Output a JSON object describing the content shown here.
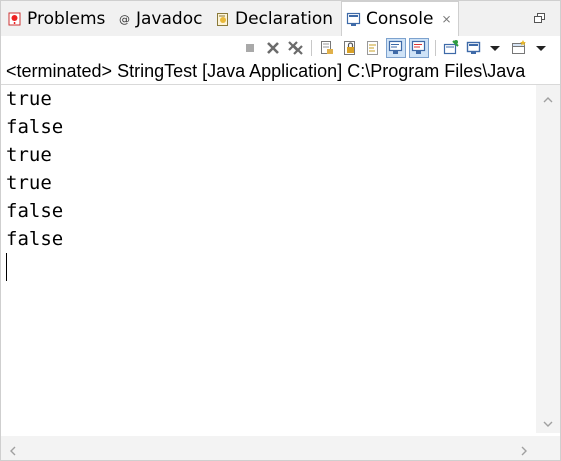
{
  "tabs": [
    {
      "label": "Problems",
      "icon": "problems-icon"
    },
    {
      "label": "Javadoc",
      "icon": "javadoc-icon"
    },
    {
      "label": "Declaration",
      "icon": "declaration-icon"
    },
    {
      "label": "Console",
      "icon": "console-icon",
      "active": true,
      "close": "⨯"
    }
  ],
  "toolbar": {
    "buttons": [
      "terminate-icon",
      "remove-launch-icon",
      "remove-all-terminated-icon",
      "clear-console-icon",
      "scroll-lock-icon",
      "word-wrap-icon",
      "show-stdout-icon",
      "show-stderr-icon",
      "pin-console-icon",
      "display-console-icon",
      "open-console-icon"
    ],
    "pressed": [
      "show-stdout-icon",
      "show-stderr-icon"
    ]
  },
  "description": "<terminated> StringTest [Java Application] C:\\Program Files\\Java",
  "console": {
    "lines": [
      "true",
      "false",
      "true",
      "true",
      "false",
      "false"
    ]
  },
  "colors": {
    "tab_bar_bg": "#f1f1f1",
    "pressed_bg": "#cfe3f7",
    "pressed_border": "#7da2ce",
    "scrollbar_bg": "#f3f3f3"
  }
}
